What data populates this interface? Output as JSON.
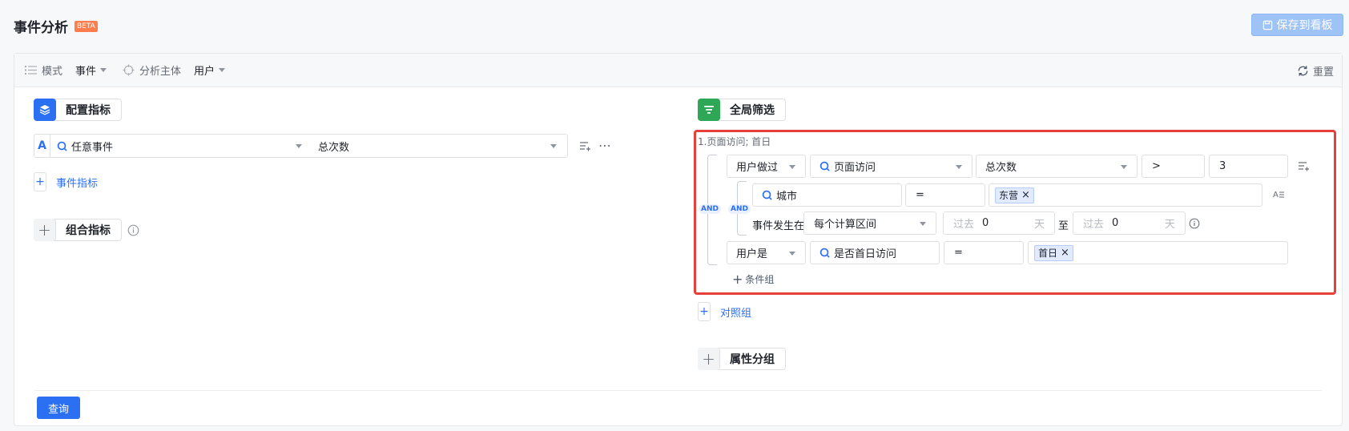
{
  "header": {
    "title": "事件分析",
    "beta": "BETA",
    "save_label": "保存到看板"
  },
  "toolbar": {
    "mode_label": "模式",
    "mode_value": "事件",
    "subject_label": "分析主体",
    "subject_value": "用户",
    "reset_label": "重置"
  },
  "metrics": {
    "section_title": "配置指标",
    "row_letter": "A",
    "event_value": "任意事件",
    "measure_value": "总次数",
    "add_event_metric": "事件指标",
    "combo_title": "组合指标"
  },
  "filter": {
    "section_title": "全局筛选",
    "summary": "1.页面访问; 首日",
    "and_label": "AND",
    "row1": {
      "type": "用户做过",
      "event": "页面访问",
      "measure": "总次数",
      "op": ">",
      "value": "3"
    },
    "row2": {
      "prop": "城市",
      "op": "=",
      "tag": "东营"
    },
    "row3": {
      "label": "事件发生在",
      "range": "每个计算区间",
      "past1": "过去",
      "num1": "0",
      "unit1": "天",
      "to": "至",
      "past2": "过去",
      "num2": "0",
      "unit2": "天"
    },
    "row4": {
      "type": "用户是",
      "prop": "是否首日访问",
      "op": "=",
      "tag": "首日"
    },
    "add_group": "条件组",
    "compare_group": "对照组"
  },
  "grouping": {
    "section_title": "属性分组"
  },
  "footer": {
    "query_label": "查询"
  },
  "colors": {
    "primary": "#2b6ff3",
    "highlight": "#e6403b",
    "beta": "#ff7d4d",
    "green": "#2ea756"
  }
}
